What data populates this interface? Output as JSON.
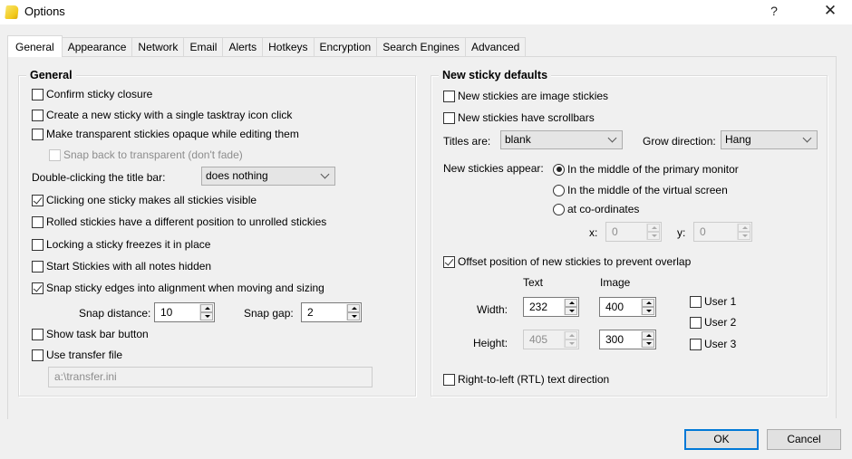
{
  "window": {
    "title": "Options",
    "app_icon": "sticky-note-icon",
    "help_label": "?",
    "close_label": "✕"
  },
  "tabs": [
    {
      "label": "General",
      "active": true
    },
    {
      "label": "Appearance",
      "active": false
    },
    {
      "label": "Network",
      "active": false
    },
    {
      "label": "Email",
      "active": false
    },
    {
      "label": "Alerts",
      "active": false
    },
    {
      "label": "Hotkeys",
      "active": false
    },
    {
      "label": "Encryption",
      "active": false
    },
    {
      "label": "Search Engines",
      "active": false
    },
    {
      "label": "Advanced",
      "active": false
    }
  ],
  "general": {
    "title": "General",
    "confirm_closure": {
      "label": "Confirm sticky closure",
      "checked": false
    },
    "single_click_new": {
      "label": "Create a new sticky with a single tasktray icon click",
      "checked": false
    },
    "opaque_editing": {
      "label": "Make transparent stickies opaque while editing them",
      "checked": false
    },
    "snap_back": {
      "label": "Snap back to transparent (don't fade)",
      "checked": false,
      "disabled": true
    },
    "double_click": {
      "label": "Double-clicking the title bar:",
      "value": "does nothing"
    },
    "click_one_visible": {
      "label": "Clicking one sticky makes all stickies visible",
      "checked": true
    },
    "rolled_position": {
      "label": "Rolled stickies have a different position to unrolled stickies",
      "checked": false
    },
    "locking_freezes": {
      "label": "Locking a sticky freezes it in place",
      "checked": false
    },
    "start_hidden": {
      "label": "Start Stickies with all notes hidden",
      "checked": false
    },
    "snap_edges": {
      "label": "Snap sticky edges into alignment when moving and sizing",
      "checked": true
    },
    "snap_distance": {
      "label": "Snap distance:",
      "value": "10"
    },
    "snap_gap": {
      "label": "Snap gap:",
      "value": "2"
    },
    "taskbar_button": {
      "label": "Show task bar button",
      "checked": false
    },
    "transfer_file": {
      "label": "Use transfer file",
      "checked": false
    },
    "transfer_path": {
      "value": "a:\\transfer.ini",
      "disabled": true
    }
  },
  "defaults": {
    "title": "New sticky defaults",
    "image_stickies": {
      "label": "New stickies are image stickies",
      "checked": false
    },
    "scrollbars": {
      "label": "New stickies have scrollbars",
      "checked": false
    },
    "titles_are": {
      "label": "Titles are:",
      "value": "blank"
    },
    "grow_direction": {
      "label": "Grow direction:",
      "value": "Hang"
    },
    "appear": {
      "label": "New stickies appear:",
      "options": [
        {
          "label": "In the middle of the primary monitor",
          "checked": true
        },
        {
          "label": "In the middle of the virtual screen",
          "checked": false
        },
        {
          "label": "at co-ordinates",
          "checked": false
        }
      ],
      "x_label": "x:",
      "x_value": "0",
      "y_label": "y:",
      "y_value": "0"
    },
    "offset": {
      "label": "Offset position of new stickies to prevent overlap",
      "checked": true
    },
    "size": {
      "text_header": "Text",
      "image_header": "Image",
      "width_label": "Width:",
      "height_label": "Height:",
      "text_width": "232",
      "text_height": "405",
      "image_width": "400",
      "image_height": "300"
    },
    "users": [
      {
        "label": "User 1",
        "checked": false
      },
      {
        "label": "User 2",
        "checked": false
      },
      {
        "label": "User 3",
        "checked": false
      }
    ],
    "rtl": {
      "label": "Right-to-left (RTL) text direction",
      "checked": false
    }
  },
  "buttons": {
    "ok": "OK",
    "cancel": "Cancel"
  }
}
